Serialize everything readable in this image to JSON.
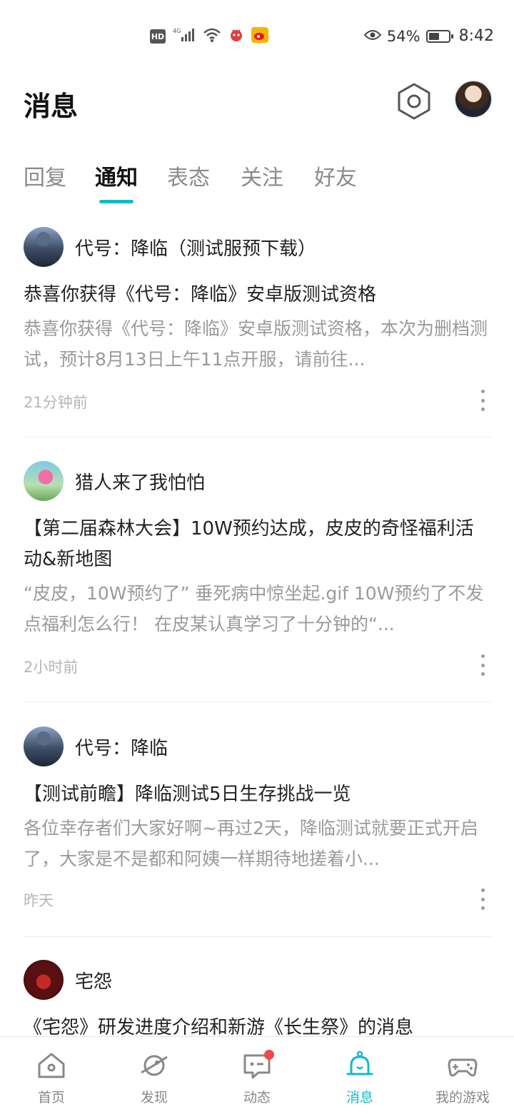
{
  "status_bar": {
    "network_badge": "HD",
    "network_type": "4G",
    "battery": "54%",
    "battery_level": 0.54,
    "time": "8:42",
    "icons": [
      "hd-icon",
      "4g-signal-icon",
      "wifi-icon",
      "app-notification-icon",
      "weibo-icon",
      "eye-icon",
      "battery-icon"
    ]
  },
  "header": {
    "title": "消息",
    "settings_icon": "hexagon-settings-icon"
  },
  "tabs": [
    {
      "label": "回复",
      "active": false
    },
    {
      "label": "通知",
      "active": true
    },
    {
      "label": "表态",
      "active": false
    },
    {
      "label": "关注",
      "active": false
    },
    {
      "label": "好友",
      "active": false
    }
  ],
  "feed": [
    {
      "author": "代号：降临（测试服预下载）",
      "title": "恭喜你获得《代号：降临》安卓版测试资格",
      "summary": "恭喜你获得《代号：降临》安卓版测试资格，本次为删档测试，预计8月13日上午11点开服，请前往...",
      "time": "21分钟前"
    },
    {
      "author": "猎人来了我怕怕",
      "title": "【第二届森林大会】10W预约达成，皮皮的奇怪福利活动&新地图",
      "summary": "“皮皮，10W预约了” 垂死病中惊坐起.gif 10W预约了不发点福利怎么行！ 在皮某认真学习了十分钟的“...",
      "time": "2小时前"
    },
    {
      "author": "代号：降临",
      "title": "【测试前瞻】降临测试5日生存挑战一览",
      "summary": "各位幸存者们大家好啊~再过2天，降临测试就要正式开启了，大家是不是都和阿姨一样期待地搓着小...",
      "time": "昨天"
    },
    {
      "author": "宅怨",
      "title": "《宅怨》研发进度介绍和新游《长生祭》的消息",
      "summary": "",
      "time": ""
    }
  ],
  "bottom_nav": [
    {
      "label": "首页",
      "icon": "home-icon",
      "active": false
    },
    {
      "label": "发现",
      "icon": "planet-icon",
      "active": false
    },
    {
      "label": "动态",
      "icon": "chat-icon",
      "active": false,
      "badge_dot": true
    },
    {
      "label": "消息",
      "icon": "bell-icon",
      "active": true
    },
    {
      "label": "我的游戏",
      "icon": "gamepad-icon",
      "active": false
    }
  ],
  "colors": {
    "accent": "#14b9c8",
    "badge": "#f04a4a",
    "text_primary": "#222222",
    "text_secondary": "#9a9a9a"
  }
}
